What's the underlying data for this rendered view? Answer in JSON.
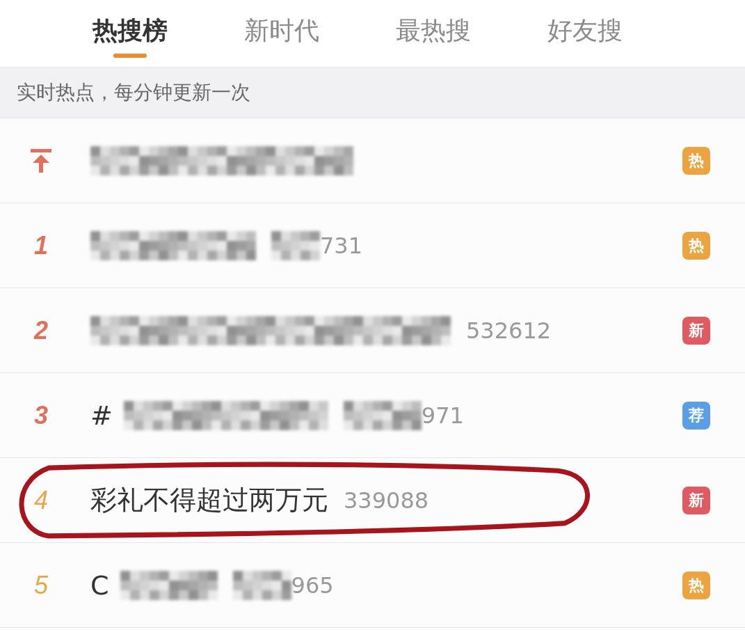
{
  "tabs": [
    {
      "label": "热搜榜",
      "selected": true
    },
    {
      "label": "新时代",
      "selected": false
    },
    {
      "label": "最热搜",
      "selected": false
    },
    {
      "label": "好友搜",
      "selected": false
    }
  ],
  "banner": "实时热点，每分钟更新一次",
  "rows": [
    {
      "kind": "pinned",
      "color": "#e0705a",
      "title_blurred": true,
      "highlighted": false,
      "badge": {
        "text": "热",
        "color": "#eba43f"
      }
    },
    {
      "kind": "rank",
      "rank": "1",
      "color": "#e0705a",
      "title_blurred": true,
      "count_blurred": true,
      "count": "731",
      "highlighted": false,
      "badge": {
        "text": "热",
        "color": "#eba43f"
      }
    },
    {
      "kind": "rank",
      "rank": "2",
      "color": "#e0705a",
      "title_blurred": true,
      "count": "532612",
      "highlighted": false,
      "badge": {
        "text": "新",
        "color": "#e05a62"
      }
    },
    {
      "kind": "rank",
      "rank": "3",
      "color": "#e0705a",
      "title": "#",
      "title_blurred": true,
      "count_blurred": true,
      "count": "971",
      "highlighted": false,
      "badge": {
        "text": "荐",
        "color": "#5a9fe6"
      }
    },
    {
      "kind": "rank",
      "rank": "4",
      "color": "#e8a64b",
      "title": "彩礼不得超过两万元",
      "count": "339088",
      "highlighted": true,
      "badge": {
        "text": "新",
        "color": "#e05a62"
      }
    },
    {
      "kind": "rank",
      "rank": "5",
      "color": "#e8a64b",
      "title": "C",
      "title_blurred": true,
      "count_blurred": true,
      "count": "965",
      "highlighted": false,
      "badge": {
        "text": "热",
        "color": "#eba43f"
      }
    }
  ]
}
